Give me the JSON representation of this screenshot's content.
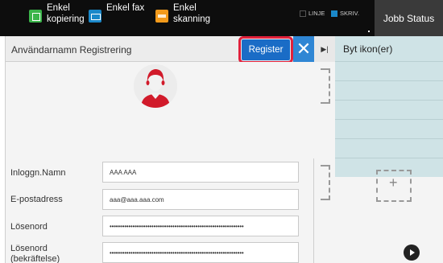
{
  "topbar": {
    "buttons": [
      {
        "label": "Enkel kopiering",
        "icon": "copy-icon",
        "color": "#3bb54a"
      },
      {
        "label": "Enkel fax",
        "icon": "fax-icon",
        "color": "#1a88c9"
      },
      {
        "label": "Enkel skanning",
        "icon": "scan-icon",
        "color": "#f29a1b"
      }
    ],
    "indicators": [
      {
        "label": "LINJE",
        "color": "#222222"
      },
      {
        "label": "SKRIV.",
        "color": "#1a88c9"
      }
    ],
    "job_status": "Jobb Status"
  },
  "dialog": {
    "title": "Användarnamn Registrering",
    "register_label": "Register",
    "close_symbol": "✕",
    "accent": "#1a6cc6",
    "highlight": "#e0203b",
    "fields": [
      {
        "label": "Inloggn.Namn",
        "value": "AAA AAA"
      },
      {
        "label": "E-postadress",
        "value": "aaa@aaa.aaa.com"
      },
      {
        "label": "Lösenord",
        "value": "••••••••••••••••••••••••••••••••••••••••••••••••••••••••••••••••"
      },
      {
        "label": "Lösenord (bekräftelse)",
        "value": "••••••••••••••••••••••••••••••••••••••••••••••••••••••••••••••••"
      }
    ]
  },
  "right_panel": {
    "title": "Byt ikon(er)",
    "add_symbol": "+"
  }
}
